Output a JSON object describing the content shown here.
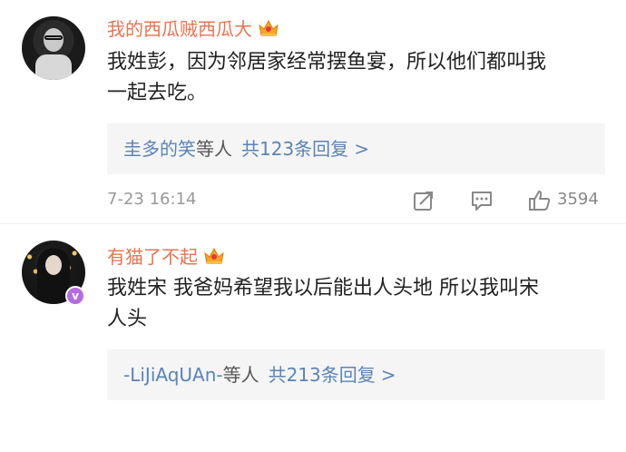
{
  "comments": [
    {
      "username": "我的西瓜贼西瓜大",
      "text_line1": "我姓彭，因为邻居家经常摆鱼宴，所以他们都叫我",
      "text_line2": "一起去吃。",
      "replies": {
        "first_user": "圭多的笑",
        "others_label": "等人",
        "count_label": "共123条回复",
        "arrow": ">"
      },
      "time": "7-23 16:14",
      "like_count": "3594"
    },
    {
      "username": "有猫了不起",
      "verified_badge": "v",
      "text_line1": "我姓宋 我爸妈希望我以后能出人头地 所以我叫宋",
      "text_line2": "人头",
      "replies": {
        "first_user": "-LiJiAqUAn-",
        "others_label": "等人",
        "count_label": "共213条回复",
        "arrow": ">"
      }
    }
  ],
  "icons": {
    "crown": "crown-icon",
    "share": "share-icon",
    "comment": "comment-icon",
    "like": "like-icon"
  },
  "colors": {
    "username": "#eb7350",
    "link": "#5a84b8",
    "reply_bg": "#f5f5f5",
    "crown": "#f5a623",
    "verified": "#b46ce0"
  }
}
